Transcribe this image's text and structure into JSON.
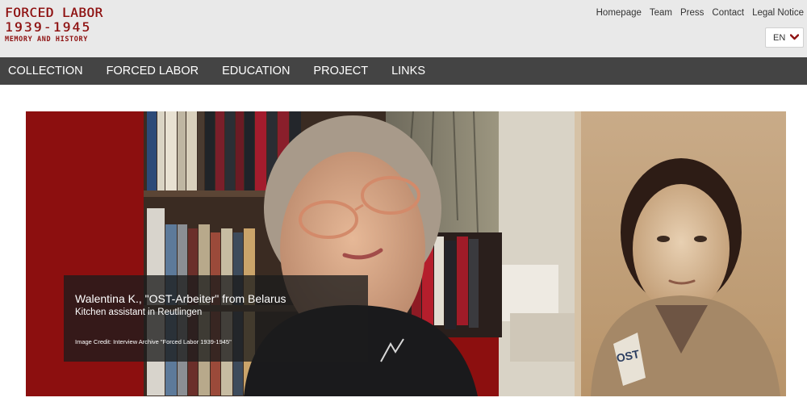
{
  "logo": {
    "line1": "FORCED LABOR",
    "line2": "1939-1945",
    "line3": "MEMORY AND HISTORY",
    "color": "#8e1111"
  },
  "utility_nav": [
    "Homepage",
    "Team",
    "Press",
    "Contact",
    "Legal Notice"
  ],
  "language": {
    "selected": "EN",
    "icon": "chevron-down-icon"
  },
  "main_nav": [
    "COLLECTION",
    "FORCED LABOR",
    "EDUCATION",
    "PROJECT",
    "LINKS"
  ],
  "hero": {
    "badge_text": "OST",
    "caption": {
      "title": "Walentina K., \"OST-Arbeiter\" from Belarus",
      "subtitle": "Kitchen assistant in Reutlingen",
      "credit": "Image Credit: Interview Archive \"Forced Labor 1939-1945\""
    }
  },
  "colors": {
    "header_bg": "#e9e9e9",
    "nav_bg": "#444444",
    "brand_red": "#8e1111"
  }
}
